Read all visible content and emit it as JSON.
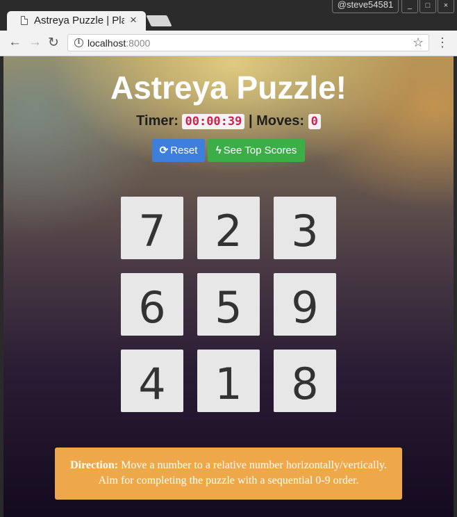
{
  "browser": {
    "tab_title": "Astreya Puzzle | Pla",
    "tab_close": "×",
    "profile": "@steve54581",
    "url_host": "localhost",
    "url_port": ":8000",
    "back": "←",
    "forward": "→",
    "reload": "↻",
    "star": "☆",
    "menu": "⋮",
    "window_buttons": [
      "_",
      "□",
      "×"
    ]
  },
  "game": {
    "title": "Astreya Puzzle!",
    "timer_label": "Timer:",
    "timer_value": "00:00:39",
    "separator": "|",
    "moves_label": "Moves:",
    "moves_value": "0",
    "reset_icon": "⟳",
    "reset_label": "Reset",
    "scores_icon": "ϟ",
    "scores_label": "See Top Scores",
    "tiles": [
      "7",
      "2",
      "3",
      "6",
      "5",
      "9",
      "4",
      "1",
      "8"
    ],
    "direction_label": "Direction:",
    "direction_text_1": "Move a number to a relative number horizontally/vertically.",
    "direction_text_2": "Aim for completing the puzzle with a sequential 0-9 order."
  },
  "colors": {
    "reset_button": "#3f7fdc",
    "scores_button": "#3cae47",
    "direction_box": "#efa849",
    "tile": "#e7e7e7",
    "code_text": "#c7254e"
  }
}
